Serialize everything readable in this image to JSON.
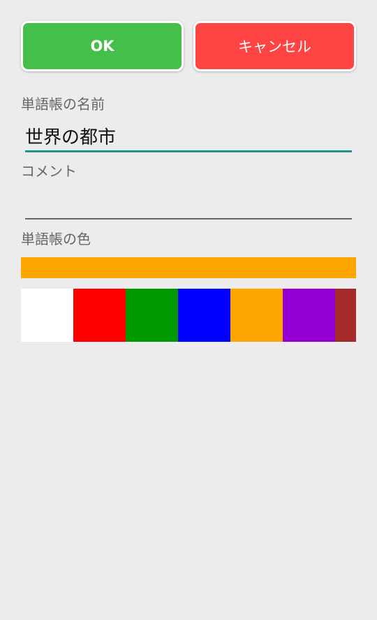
{
  "buttons": {
    "ok_label": "OK",
    "ok_color": "#44c04a",
    "cancel_label": "キャンセル",
    "cancel_color": "#ff4444"
  },
  "form": {
    "name_label": "単語帳の名前",
    "name_value": "世界の都市",
    "comment_label": "コメント",
    "comment_value": "",
    "color_label": "単語帳の色",
    "selected_color": "#ffa500"
  },
  "swatches": [
    {
      "name": "white",
      "color": "#ffffff"
    },
    {
      "name": "red",
      "color": "#ff0000"
    },
    {
      "name": "green",
      "color": "#009a00"
    },
    {
      "name": "blue",
      "color": "#0000ff"
    },
    {
      "name": "orange",
      "color": "#ffa500"
    },
    {
      "name": "purple",
      "color": "#9400d3"
    },
    {
      "name": "brown",
      "color": "#a52a2a"
    }
  ]
}
